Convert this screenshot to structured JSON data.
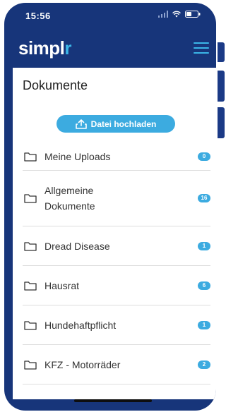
{
  "status_bar": {
    "time": "15:56"
  },
  "header": {
    "logo_text": "simpl",
    "logo_accent": "r",
    "menu_icon": "hamburger-menu-icon"
  },
  "page": {
    "title": "Dokumente"
  },
  "upload": {
    "label": "Datei hochladen",
    "icon": "upload-icon"
  },
  "folders": [
    {
      "label": "Meine Uploads",
      "count": "0"
    },
    {
      "label": "Allgemeine Dokumente",
      "count": "16"
    },
    {
      "label": "Dread Disease",
      "count": "1"
    },
    {
      "label": "Hausrat",
      "count": "6"
    },
    {
      "label": "Hundehaftpflicht",
      "count": "1"
    },
    {
      "label": "KFZ - Motorräder",
      "count": "2"
    }
  ],
  "colors": {
    "navy": "#17357a",
    "accent": "#3cabe0",
    "logo_accent": "#3bb6e8"
  }
}
